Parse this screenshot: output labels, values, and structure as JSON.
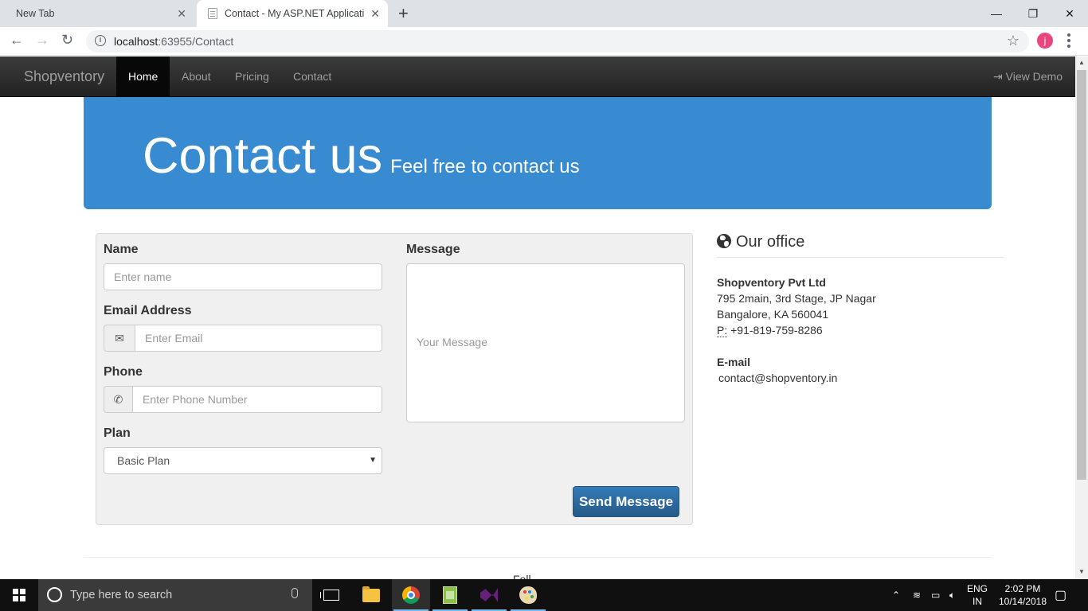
{
  "browser": {
    "tabs": [
      {
        "title": "New Tab"
      },
      {
        "title": "Contact - My ASP.NET Application"
      }
    ],
    "tab_close": "✕",
    "new_tab": "+",
    "window_controls": {
      "minimize": "—",
      "restore": "❐",
      "close": "✕"
    },
    "url": {
      "host": "localhost",
      "path": ":63955/Contact"
    },
    "profile_initial": "j",
    "accent_profile": "#e8467c"
  },
  "navbar": {
    "brand": "Shopventory",
    "links": [
      "Home",
      "About",
      "Pricing",
      "Contact"
    ],
    "active": "Home",
    "view_demo": "View Demo",
    "view_demo_icon": "sign-in-icon"
  },
  "jumbotron": {
    "title": "Contact us",
    "subtitle": "Feel free to contact us",
    "color": "#388bd1"
  },
  "form": {
    "name_label": "Name",
    "name_placeholder": "Enter name",
    "email_label": "Email Address",
    "email_placeholder": "Enter Email",
    "email_icon": "envelope-icon",
    "phone_label": "Phone",
    "phone_placeholder": "Enter Phone Number",
    "phone_icon": "phone-icon",
    "plan_label": "Plan",
    "plan_selected": "Basic Plan",
    "message_label": "Message",
    "message_placeholder": "Your Message",
    "send_button": "Send Message"
  },
  "office": {
    "heading": "Our office",
    "company": "Shopventory Pvt Ltd",
    "address_line1": "795 2main, 3rd Stage, JP Nagar",
    "address_line2": "Bangalore, KA 560041",
    "phone_abbr": "P:",
    "phone": "+91-819-759-8286",
    "email_label": "E-mail",
    "email": "contact@shopventory.in"
  },
  "footer": {
    "partial_text": "Foll"
  },
  "taskbar": {
    "search_placeholder": "Type here to search",
    "lang_line1": "ENG",
    "lang_line2": "IN",
    "time": "2:02 PM",
    "date": "10/14/2018"
  }
}
